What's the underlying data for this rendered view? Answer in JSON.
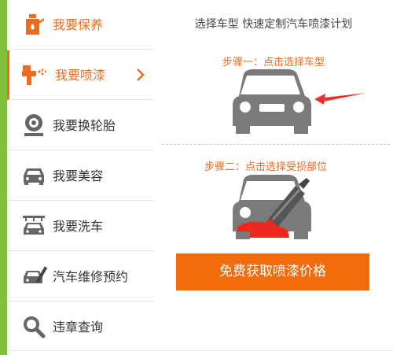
{
  "colors": {
    "accent": "#f26b1d",
    "button": "#f26b0c",
    "sidebar_strip": "#7fbf3a",
    "car_gray": "#7a7a7a",
    "arrow_red": "#e83030"
  },
  "sidebar": {
    "items": [
      {
        "label": "我要保养",
        "icon": "oil-can-icon",
        "state": "highlighted"
      },
      {
        "label": "我要喷漆",
        "icon": "spray-gun-icon",
        "state": "selected"
      },
      {
        "label": "我要换轮胎",
        "icon": "tire-icon",
        "state": "normal"
      },
      {
        "label": "我要美容",
        "icon": "car-beauty-icon",
        "state": "normal"
      },
      {
        "label": "我要洗车",
        "icon": "car-wash-icon",
        "state": "normal"
      },
      {
        "label": "汽车维修预约",
        "icon": "repair-tools-icon",
        "state": "normal"
      },
      {
        "label": "违章查询",
        "icon": "search-icon",
        "state": "normal"
      }
    ]
  },
  "main": {
    "headline": "选择车型 快速定制汽车喷漆计划",
    "step1": "步骤一：点击选择车型",
    "step2": "步骤二：点击选择受损部位",
    "cta_label": "免费获取喷漆价格"
  }
}
